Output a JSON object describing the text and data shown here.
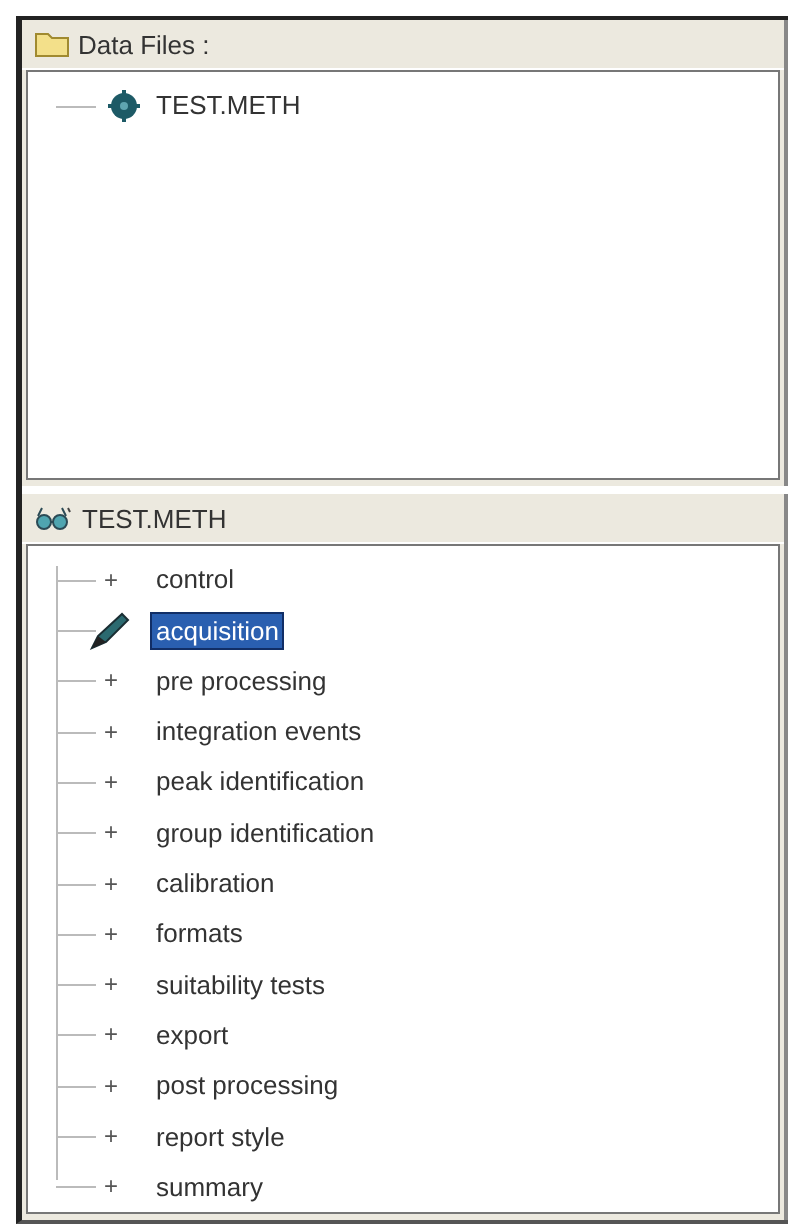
{
  "data_files": {
    "title": "Data Files :",
    "items": [
      {
        "label": "TEST.METH",
        "selected": false
      }
    ]
  },
  "method": {
    "title": "TEST.METH",
    "items": [
      {
        "label": "control",
        "expander": "+",
        "selected": false
      },
      {
        "label": "acquisition",
        "selected": true
      },
      {
        "label": "pre processing",
        "expander": "+",
        "selected": false
      },
      {
        "label": "integration events",
        "expander": "+",
        "selected": false
      },
      {
        "label": "peak identification",
        "expander": "+",
        "selected": false
      },
      {
        "label": "group identification",
        "expander": "+",
        "selected": false
      },
      {
        "label": "calibration",
        "expander": "+",
        "selected": false
      },
      {
        "label": "formats",
        "expander": "+",
        "selected": false
      },
      {
        "label": "suitability tests",
        "expander": "+",
        "selected": false
      },
      {
        "label": "export",
        "expander": "+",
        "selected": false
      },
      {
        "label": "post processing",
        "expander": "+",
        "selected": false
      },
      {
        "label": "report style",
        "expander": "+",
        "selected": false
      },
      {
        "label": "summary",
        "expander": "+",
        "selected": false
      }
    ]
  }
}
